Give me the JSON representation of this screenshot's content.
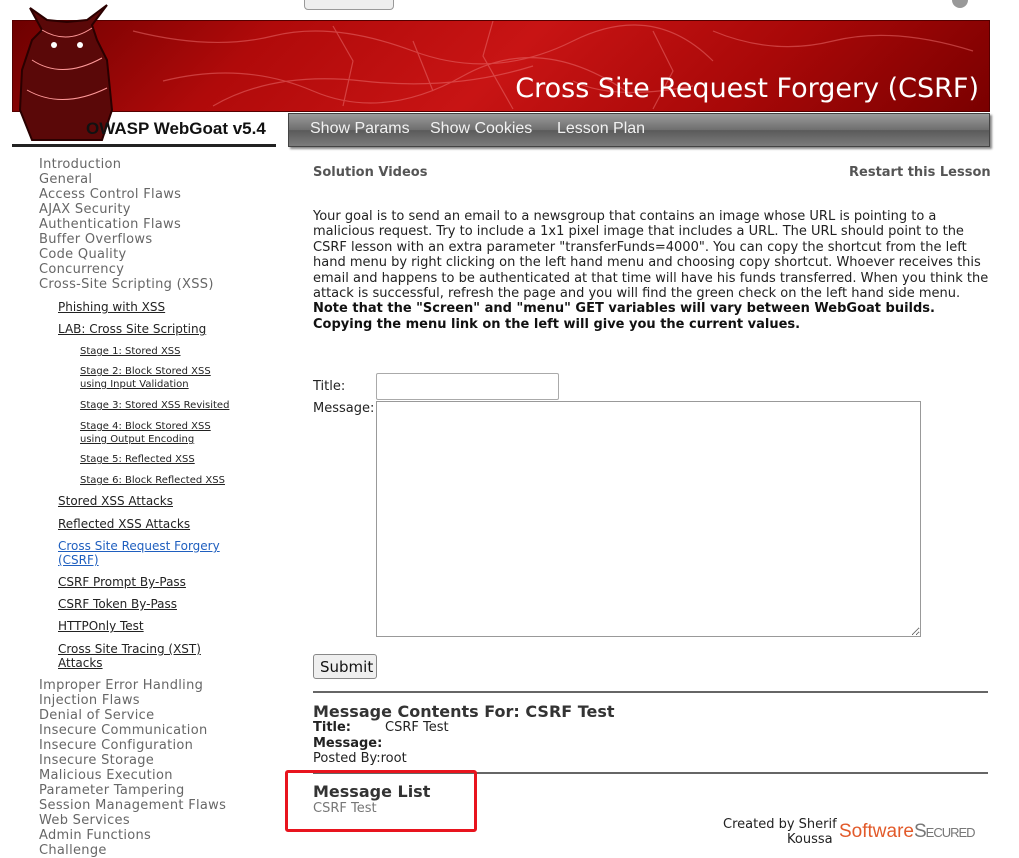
{
  "header": {
    "banner_title": "Cross Site Request Forgery (CSRF)",
    "brand": "OWASP WebGoat  v5.4",
    "nav": [
      "Show Params",
      "Show Cookies",
      "Lesson Plan"
    ]
  },
  "menu": {
    "categories_top": [
      "Introduction",
      "General",
      "Access Control Flaws",
      "AJAX Security",
      "Authentication Flaws",
      "Buffer Overflows",
      "Code Quality",
      "Concurrency",
      "Cross-Site Scripting (XSS)"
    ],
    "xss_items": {
      "phishing": "Phishing with XSS",
      "lab": "LAB: Cross Site Scripting",
      "stage1": "Stage 1: Stored XSS",
      "stage2": "Stage 2: Block Stored XSS using Input Validation",
      "stage3": "Stage 3: Stored XSS Revisited",
      "stage4": "Stage 4: Block Stored XSS using Output Encoding",
      "stage5": "Stage 5: Reflected XSS",
      "stage6": "Stage 6: Block Reflected XSS",
      "stored": "Stored XSS Attacks",
      "reflected": "Reflected XSS Attacks",
      "csrf": "Cross Site Request Forgery (CSRF)",
      "csrf_prompt": "CSRF Prompt By-Pass",
      "csrf_token": "CSRF Token By-Pass",
      "httponly": "HTTPOnly Test",
      "xst": "Cross Site Tracing (XST) Attacks"
    },
    "categories_bottom": [
      "Improper Error Handling",
      "Injection Flaws",
      "Denial of Service",
      "Insecure Communication",
      "Insecure Configuration",
      "Insecure Storage",
      "Malicious Execution",
      "Parameter Tampering",
      "Session Management Flaws",
      "Web Services",
      "Admin Functions",
      "Challenge"
    ]
  },
  "content": {
    "solution_videos": "Solution Videos",
    "restart": "Restart this Lesson",
    "goal": "Your goal is to send an email to a newsgroup that contains an image whose URL is pointing to a malicious request. Try to include a 1x1 pixel image that includes a URL. The URL should point to the CSRF lesson with an extra parameter \"transferFunds=4000\". You can copy the shortcut from the left hand menu by right clicking on the left hand menu and choosing copy shortcut. Whoever receives this email and happens to be authenticated at that time will have his funds transferred. When you think the attack is successful, refresh the page and you will find the green check on the left hand side menu.",
    "note": "Note that the \"Screen\" and \"menu\" GET variables will vary between WebGoat builds. Copying the menu link on the left will give you the current values.",
    "title_label": "Title:",
    "title_value": "",
    "message_label": "Message:",
    "message_value": "",
    "submit": "Submit"
  },
  "message_contents": {
    "heading": "Message Contents For: CSRF Test",
    "title_label": "Title:",
    "title_value": "CSRF Test",
    "message_label": "Message:",
    "posted_by": "Posted By:root"
  },
  "message_list": {
    "heading": "Message List",
    "items": [
      "CSRF Test"
    ]
  },
  "footer": {
    "created_by_1": "Created by Sherif",
    "created_by_2": "Koussa",
    "logo_a": "Software",
    "logo_b": "Secured"
  },
  "colors": {
    "banner_red": "#c81414",
    "highlight_box": "#e8141e",
    "active_link": "#1f5fbf"
  }
}
